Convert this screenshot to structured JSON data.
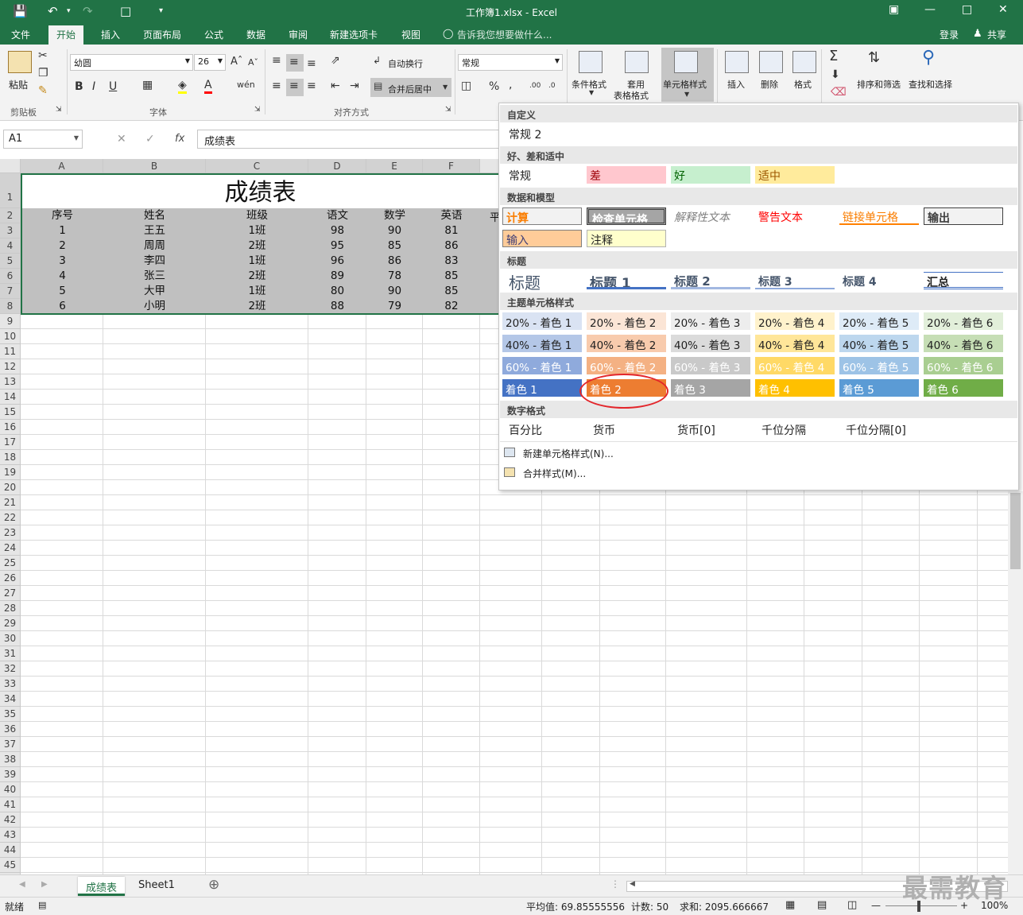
{
  "app": {
    "title": "工作簿1.xlsx - Excel",
    "login": "登录",
    "share": "共享"
  },
  "tabs": [
    "文件",
    "开始",
    "插入",
    "页面布局",
    "公式",
    "数据",
    "审阅",
    "新建选项卡",
    "视图"
  ],
  "tellme": "告诉我您想要做什么...",
  "ribbon": {
    "paste": "粘贴",
    "clipboard": "剪贴板",
    "font_name": "幼圆",
    "font_size": "26",
    "font_group": "字体",
    "wrap_text": "自动换行",
    "merge_center": "合并后居中",
    "align_group": "对齐方式",
    "number_format": "常规",
    "cond_format": "条件格式",
    "table_format_1": "套用",
    "table_format_2": "表格格式",
    "cell_styles": "单元格样式",
    "insert": "插入",
    "delete": "删除",
    "format": "格式",
    "sort_filter": "排序和筛选",
    "find_select": "查找和选择"
  },
  "formula": {
    "namebox": "A1",
    "content": "成绩表"
  },
  "sheet": {
    "columns": [
      "A",
      "B",
      "C",
      "D",
      "E",
      "F"
    ],
    "title": "成绩表",
    "headers": [
      "序号",
      "姓名",
      "班级",
      "语文",
      "数学",
      "英语"
    ],
    "header_partial": "平",
    "rows": [
      [
        "1",
        "王五",
        "1班",
        "98",
        "90",
        "81"
      ],
      [
        "2",
        "周周",
        "2班",
        "95",
        "85",
        "86"
      ],
      [
        "3",
        "李四",
        "1班",
        "96",
        "86",
        "83"
      ],
      [
        "4",
        "张三",
        "2班",
        "89",
        "78",
        "85"
      ],
      [
        "5",
        "大甲",
        "1班",
        "80",
        "90",
        "85"
      ],
      [
        "6",
        "小明",
        "2班",
        "88",
        "79",
        "82"
      ]
    ],
    "tabs": [
      "成绩表",
      "Sheet1"
    ]
  },
  "status": {
    "ready": "就绪",
    "average": "平均值: 69.85555556",
    "count": "计数: 50",
    "sum": "求和: 2095.666667",
    "zoom": "100%"
  },
  "dropdown": {
    "sec_custom": "自定义",
    "custom_items": [
      "常规 2"
    ],
    "sec_good": "好、差和适中",
    "good_items": [
      "常规",
      "差",
      "好",
      "适中"
    ],
    "sec_data": "数据和模型",
    "data_items": [
      "计算",
      "检查单元格",
      "解释性文本",
      "警告文本",
      "链接单元格",
      "输出",
      "输入",
      "注释"
    ],
    "sec_title": "标题",
    "title_items": [
      "标题",
      "标题 1",
      "标题 2",
      "标题 3",
      "标题 4",
      "汇总"
    ],
    "sec_theme": "主题单元格样式",
    "theme_rows": [
      [
        "20% - 着色 1",
        "20% - 着色 2",
        "20% - 着色 3",
        "20% - 着色 4",
        "20% - 着色 5",
        "20% - 着色 6"
      ],
      [
        "40% - 着色 1",
        "40% - 着色 2",
        "40% - 着色 3",
        "40% - 着色 4",
        "40% - 着色 5",
        "40% - 着色 6"
      ],
      [
        "60% - 着色 1",
        "60% - 着色 2",
        "60% - 着色 3",
        "60% - 着色 4",
        "60% - 着色 5",
        "60% - 着色 6"
      ],
      [
        "着色 1",
        "着色 2",
        "着色 3",
        "着色 4",
        "着色 5",
        "着色 6"
      ]
    ],
    "sec_number": "数字格式",
    "number_items": [
      "百分比",
      "货币",
      "货币[0]",
      "千位分隔",
      "千位分隔[0]"
    ],
    "new_style": "新建单元格样式(N)...",
    "merge_style": "合并样式(M)..."
  },
  "watermark": "最需教育",
  "colors": {
    "excel_green": "#217346",
    "accent1": "#4472c4",
    "accent2": "#ed7d31",
    "accent3": "#a5a5a5",
    "accent4": "#ffc000",
    "accent5": "#5b9bd5",
    "accent6": "#70ad47",
    "highlight_circle": "#e3262b"
  }
}
